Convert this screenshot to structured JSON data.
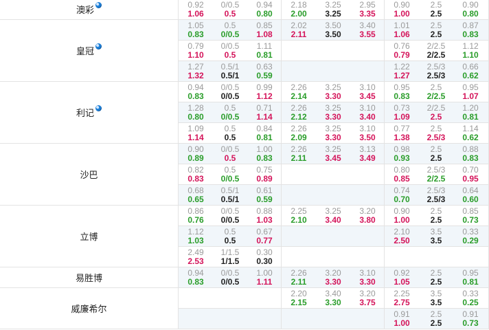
{
  "groups": [
    {
      "name": "澳彩",
      "ball": true,
      "rows": [
        {
          "bg": false,
          "c": [
            [
              "0.92",
              "1.06",
              "red"
            ],
            [
              "0/0.5",
              "0.5",
              "red"
            ],
            [
              "0.94",
              "0.80",
              "green"
            ],
            [
              "2.18",
              "2.00",
              "green"
            ],
            [
              "3.25",
              "3.25",
              "black"
            ],
            [
              "2.95",
              "3.35",
              "red"
            ],
            [
              "0.90",
              "1.00",
              "red"
            ],
            [
              "2.5",
              "2.5",
              "black"
            ],
            [
              "0.90",
              "0.80",
              "green"
            ]
          ]
        }
      ]
    },
    {
      "name": "皇冠",
      "ball": true,
      "rows": [
        {
          "bg": true,
          "c": [
            [
              "1.05",
              "0.83",
              "green"
            ],
            [
              "0.5",
              "0/0.5",
              "green"
            ],
            [
              "0.85",
              "1.08",
              "red"
            ],
            [
              "2.02",
              "2.11",
              "red"
            ],
            [
              "3.50",
              "3.50",
              "black"
            ],
            [
              "3.40",
              "3.55",
              "red"
            ],
            [
              "1.01",
              "1.06",
              "red"
            ],
            [
              "2.5",
              "2.5",
              "black"
            ],
            [
              "0.87",
              "0.83",
              "green"
            ]
          ]
        },
        {
          "bg": false,
          "c": [
            [
              "0.79",
              "1.10",
              "red"
            ],
            [
              "0/0.5",
              "0.5",
              "red"
            ],
            [
              "1.11",
              "0.81",
              "green"
            ],
            null,
            null,
            null,
            [
              "0.76",
              "0.79",
              "red"
            ],
            [
              "2/2.5",
              "2/2.5",
              "black"
            ],
            [
              "1.12",
              "1.10",
              "green"
            ]
          ]
        },
        {
          "bg": true,
          "c": [
            [
              "1.27",
              "1.32",
              "red"
            ],
            [
              "0.5/1",
              "0.5/1",
              "black"
            ],
            [
              "0.63",
              "0.59",
              "green"
            ],
            null,
            null,
            null,
            [
              "1.22",
              "1.27",
              "red"
            ],
            [
              "2.5/3",
              "2.5/3",
              "black"
            ],
            [
              "0.66",
              "0.62",
              "green"
            ]
          ]
        }
      ]
    },
    {
      "name": "利记",
      "ball": true,
      "rows": [
        {
          "bg": false,
          "c": [
            [
              "0.94",
              "0.83",
              "green"
            ],
            [
              "0/0.5",
              "0/0.5",
              "black"
            ],
            [
              "0.99",
              "1.12",
              "red"
            ],
            [
              "2.26",
              "2.14",
              "green"
            ],
            [
              "3.25",
              "3.30",
              "red"
            ],
            [
              "3.10",
              "3.45",
              "red"
            ],
            [
              "0.95",
              "0.83",
              "green"
            ],
            [
              "2.5",
              "2/2.5",
              "green"
            ],
            [
              "0.95",
              "1.07",
              "red"
            ]
          ]
        },
        {
          "bg": true,
          "c": [
            [
              "1.28",
              "0.80",
              "green"
            ],
            [
              "0.5",
              "0/0.5",
              "green"
            ],
            [
              "0.71",
              "1.14",
              "red"
            ],
            [
              "2.26",
              "2.12",
              "green"
            ],
            [
              "3.25",
              "3.30",
              "red"
            ],
            [
              "3.10",
              "3.40",
              "red"
            ],
            [
              "0.73",
              "1.09",
              "red"
            ],
            [
              "2/2.5",
              "2.5",
              "red"
            ],
            [
              "1.20",
              "0.81",
              "green"
            ]
          ]
        },
        {
          "bg": false,
          "c": [
            [
              "1.09",
              "1.14",
              "red"
            ],
            [
              "0.5",
              "0.5",
              "black"
            ],
            [
              "0.84",
              "0.81",
              "green"
            ],
            [
              "2.26",
              "2.09",
              "green"
            ],
            [
              "3.25",
              "3.30",
              "red"
            ],
            [
              "3.10",
              "3.50",
              "red"
            ],
            [
              "0.77",
              "1.38",
              "red"
            ],
            [
              "2.5",
              "2.5/3",
              "red"
            ],
            [
              "1.14",
              "0.62",
              "green"
            ]
          ]
        }
      ]
    },
    {
      "name": "沙巴",
      "ball": false,
      "rows": [
        {
          "bg": true,
          "c": [
            [
              "0.90",
              "0.89",
              "green"
            ],
            [
              "0/0.5",
              "0.5",
              "red"
            ],
            [
              "1.00",
              "0.83",
              "green"
            ],
            [
              "2.26",
              "2.11",
              "green"
            ],
            [
              "3.25",
              "3.45",
              "red"
            ],
            [
              "3.13",
              "3.49",
              "red"
            ],
            [
              "0.98",
              "0.93",
              "green"
            ],
            [
              "2.5",
              "2.5",
              "black"
            ],
            [
              "0.88",
              "0.83",
              "green"
            ]
          ]
        },
        {
          "bg": false,
          "c": [
            [
              "0.82",
              "0.83",
              "red"
            ],
            [
              "0.5",
              "0/0.5",
              "green"
            ],
            [
              "0.75",
              "0.89",
              "red"
            ],
            null,
            null,
            null,
            [
              "0.80",
              "0.85",
              "red"
            ],
            [
              "2.5/3",
              "2/2.5",
              "green"
            ],
            [
              "0.70",
              "0.95",
              "red"
            ]
          ]
        },
        {
          "bg": true,
          "c": [
            [
              "0.68",
              "0.65",
              "green"
            ],
            [
              "0.5/1",
              "0.5/1",
              "black"
            ],
            [
              "0.61",
              "0.59",
              "green"
            ],
            null,
            null,
            null,
            [
              "0.74",
              "0.70",
              "green"
            ],
            [
              "2.5/3",
              "2.5/3",
              "black"
            ],
            [
              "0.64",
              "0.60",
              "green"
            ]
          ]
        }
      ]
    },
    {
      "name": "立博",
      "ball": false,
      "rows": [
        {
          "bg": false,
          "c": [
            [
              "0.86",
              "0.76",
              "green"
            ],
            [
              "0/0.5",
              "0/0.5",
              "black"
            ],
            [
              "0.88",
              "1.03",
              "red"
            ],
            [
              "2.25",
              "2.10",
              "green"
            ],
            [
              "3.25",
              "3.40",
              "red"
            ],
            [
              "3.20",
              "3.80",
              "red"
            ],
            [
              "0.90",
              "1.00",
              "red"
            ],
            [
              "2.5",
              "2.5",
              "black"
            ],
            [
              "0.85",
              "0.73",
              "green"
            ]
          ]
        },
        {
          "bg": true,
          "c": [
            [
              "1.12",
              "1.03",
              "green"
            ],
            [
              "0.5",
              "0.5",
              "black"
            ],
            [
              "0.67",
              "0.77",
              "red"
            ],
            null,
            null,
            null,
            [
              "2.10",
              "2.50",
              "red"
            ],
            [
              "3.5",
              "3.5",
              "black"
            ],
            [
              "0.33",
              "0.29",
              "green"
            ]
          ]
        },
        {
          "bg": false,
          "c": [
            [
              "2.49",
              "2.53",
              "red"
            ],
            [
              "1/1.5",
              "1/1.5",
              "black"
            ],
            [
              "0.30",
              "0.30",
              "black"
            ],
            null,
            null,
            null,
            null,
            null,
            null
          ]
        }
      ]
    },
    {
      "name": "易胜博",
      "ball": false,
      "rows": [
        {
          "bg": true,
          "c": [
            [
              "0.94",
              "0.83",
              "green"
            ],
            [
              "0/0.5",
              "0/0.5",
              "black"
            ],
            [
              "1.00",
              "1.11",
              "red"
            ],
            [
              "2.26",
              "2.11",
              "green"
            ],
            [
              "3.20",
              "3.30",
              "red"
            ],
            [
              "3.10",
              "3.30",
              "red"
            ],
            [
              "0.92",
              "1.05",
              "red"
            ],
            [
              "2.5",
              "2.5",
              "black"
            ],
            [
              "0.95",
              "0.81",
              "green"
            ]
          ]
        }
      ]
    },
    {
      "name": "威廉希尔",
      "ball": false,
      "rows": [
        {
          "bg": false,
          "c": [
            null,
            null,
            null,
            [
              "2.20",
              "2.15",
              "green"
            ],
            [
              "3.40",
              "3.30",
              "green"
            ],
            [
              "3.20",
              "3.75",
              "red"
            ],
            [
              "2.25",
              "2.75",
              "red"
            ],
            [
              "3.5",
              "3.5",
              "black"
            ],
            [
              "0.33",
              "0.25",
              "green"
            ]
          ]
        },
        {
          "bg": true,
          "c": [
            null,
            null,
            null,
            null,
            null,
            null,
            [
              "0.91",
              "1.00",
              "red"
            ],
            [
              "2.5",
              "2.5",
              "black"
            ],
            [
              "0.91",
              "0.73",
              "green"
            ]
          ]
        }
      ]
    }
  ],
  "colors": {
    "red": "#d4145a",
    "green": "#2a9d2a",
    "line": "#e3e3e3",
    "rowbg": "#f1f6fa"
  }
}
